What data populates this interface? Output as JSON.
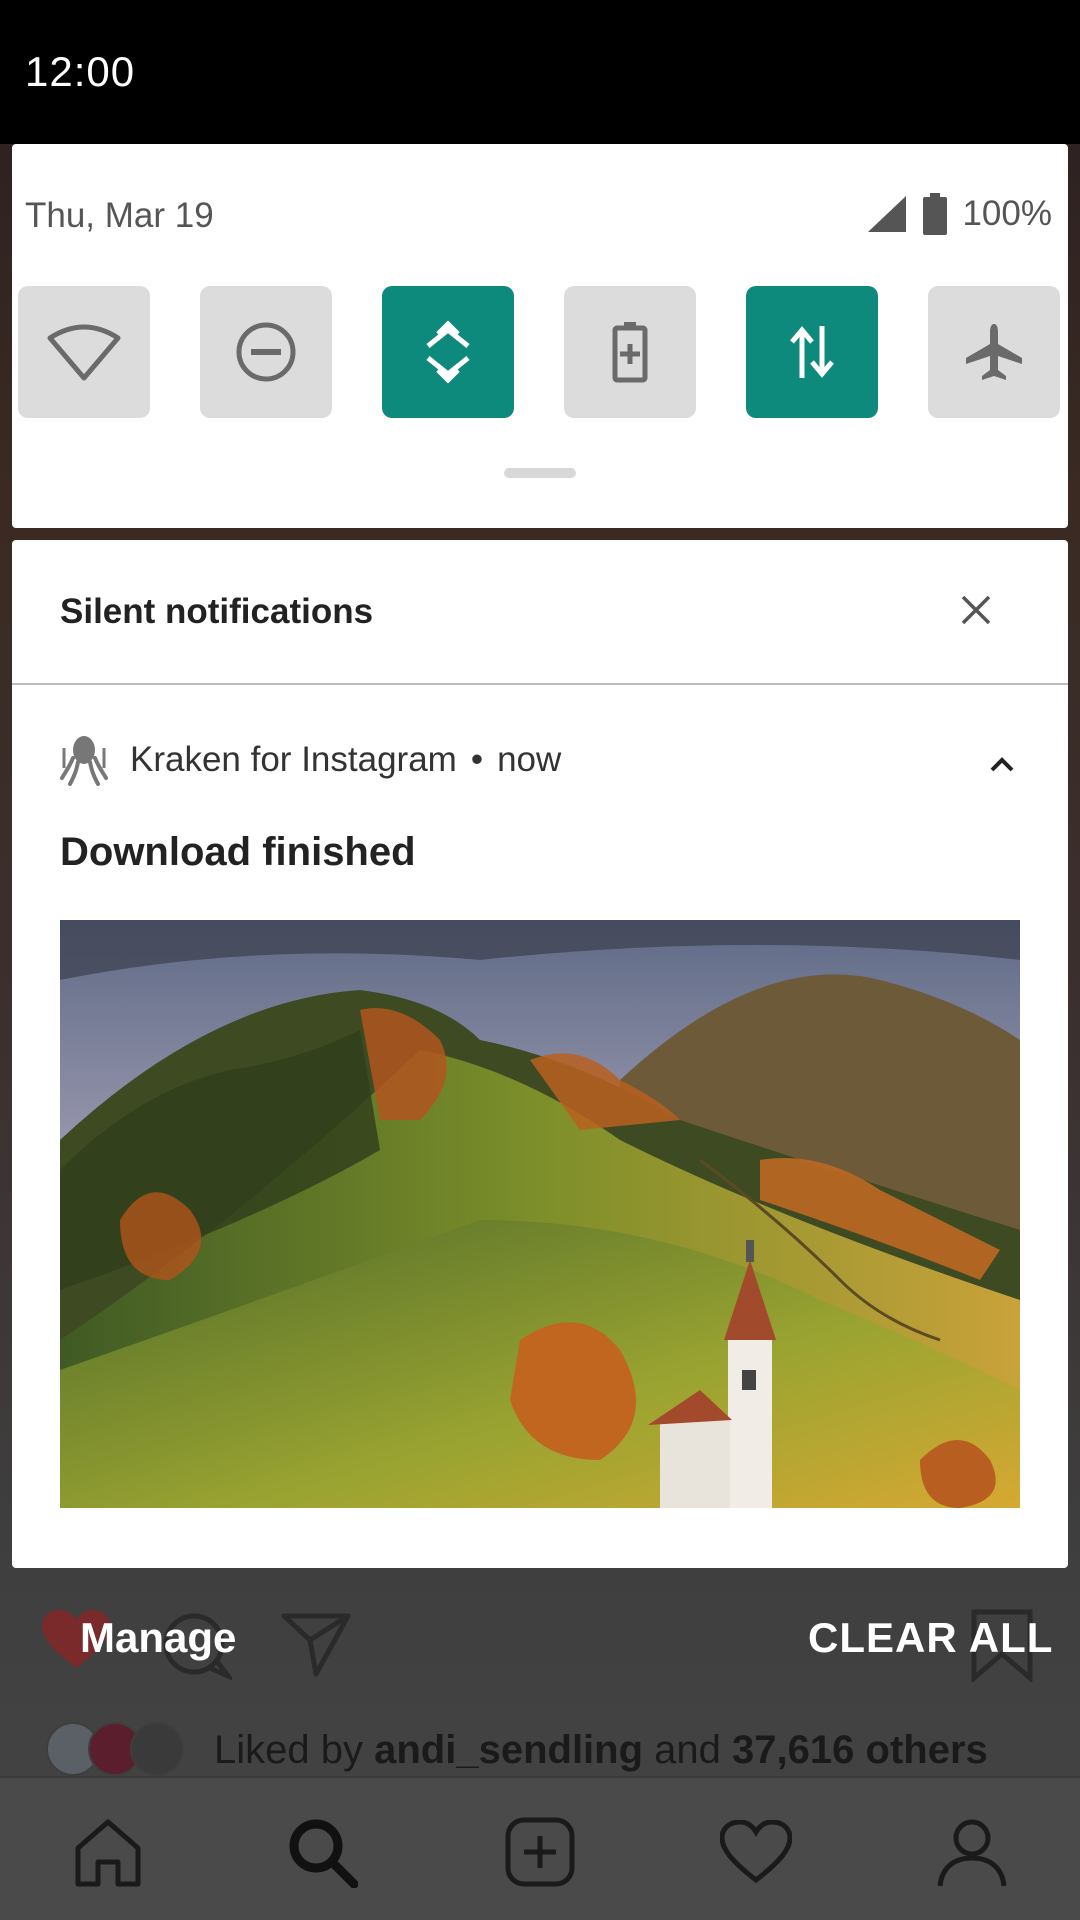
{
  "status_bar": {
    "time": "12:00"
  },
  "quick_settings": {
    "date": "Thu, Mar 19",
    "battery": "100%",
    "tiles": [
      {
        "icon": "wifi-icon",
        "state": "off"
      },
      {
        "icon": "do-not-disturb-icon",
        "state": "off"
      },
      {
        "icon": "auto-rotate-icon",
        "state": "on"
      },
      {
        "icon": "battery-saver-icon",
        "state": "off"
      },
      {
        "icon": "mobile-data-icon",
        "state": "on"
      },
      {
        "icon": "airplane-mode-icon",
        "state": "off"
      }
    ],
    "accent_color": "#0e8a7c"
  },
  "notifications": {
    "section_title": "Silent notifications",
    "item": {
      "app_name": "Kraken for Instagram",
      "separator": "•",
      "time": "now",
      "title": "Download finished",
      "image_icon": "landscape-image"
    }
  },
  "background_app": {
    "manage_label": "Manage",
    "clear_all_label": "CLEAR ALL",
    "likes": {
      "prefix": "Liked by",
      "user": "andi_sendling",
      "connector": "and",
      "count": "37,616 others"
    },
    "nav": [
      "home-icon",
      "search-icon",
      "add-post-icon",
      "activity-heart-icon",
      "profile-icon"
    ]
  }
}
